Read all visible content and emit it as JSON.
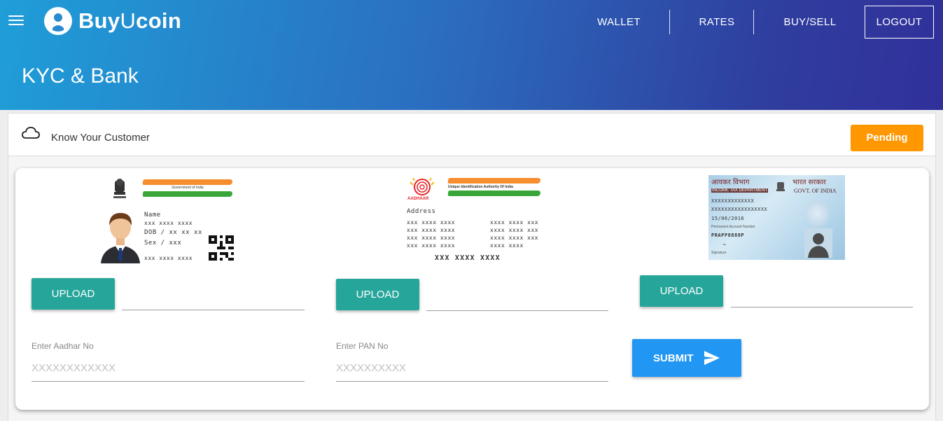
{
  "header": {
    "logo": {
      "brand_bold": "Buy",
      "brand_light": "U",
      "brand_rest": "coin"
    },
    "nav": {
      "wallet": "WALLET",
      "rates": "RATES",
      "buysell": "BUY/SELL",
      "logout": "LOGOUT"
    },
    "page_title": "KYC & Bank"
  },
  "kyc": {
    "label": "Know Your Customer",
    "status": "Pending",
    "status_color": "#ff9800"
  },
  "documents": {
    "aadhar_front": {
      "gov_text": "Government of India",
      "name_label": "Name",
      "name_value": "xxx xxxx xxxx",
      "dob": "DOB /  xx xx xx",
      "sex": "Sex /  xxx",
      "number": "xxx xxxx xxxx",
      "upload": "UPLOAD"
    },
    "aadhar_back": {
      "authority_text": "Unique Identification Authority Of India",
      "logo_text": "AADHAAR",
      "address_label": "Address",
      "address_lines_left": [
        "xxx xxxx xxxx",
        "xxx xxxx xxxx",
        "xxx xxxx xxxx",
        "xxx xxxx xxxx"
      ],
      "address_lines_right": [
        "xxxx xxxx xxx",
        "xxxx xxxx xxx",
        "xxxx xxxx xxx",
        "xxxx xxxx"
      ],
      "number": "XXX XXXX XXXX",
      "upload": "UPLOAD"
    },
    "pan": {
      "dept_hindi": "आयकर विभाग",
      "gov_hindi": "भारत सरकार",
      "dept": "INCOME TAX DEPARTMENT",
      "gov": "GOVT. OF INDIA",
      "name1": "XXXXXXXXXXXXX",
      "name2": "XXXXXXXXXXXXXXXXX",
      "dob": "15/06/2016",
      "pan_label": "Permanent Account Number",
      "pan_number": "PRAPP8888P",
      "signature_label": "Signature",
      "upload": "UPLOAD"
    }
  },
  "form": {
    "aadhar": {
      "label": "Enter Aadhar No",
      "placeholder": "XXXXXXXXXXXX"
    },
    "pan": {
      "label": "Enter PAN No",
      "placeholder": "XXXXXXXXXX"
    },
    "submit": "SUBMIT"
  }
}
